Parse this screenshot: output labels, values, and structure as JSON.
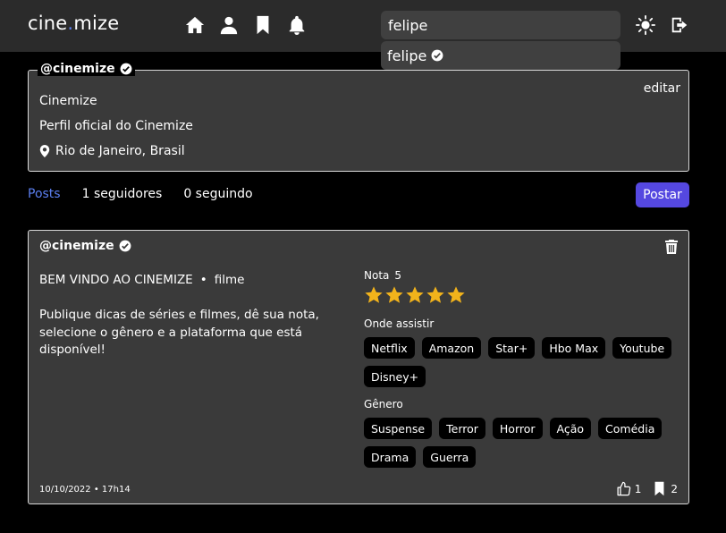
{
  "app": {
    "logo_left": "cine",
    "logo_dot": ".",
    "logo_right": "mize"
  },
  "nav": {
    "icons": [
      "home-icon",
      "user-icon",
      "bookmark-icon",
      "bell-icon"
    ],
    "right_icons": [
      "sun-icon",
      "logout-icon"
    ]
  },
  "search": {
    "value": "felipe",
    "results": [
      {
        "name": "felipe",
        "verified": true
      }
    ]
  },
  "profile": {
    "handle": "@cinemize",
    "verified": true,
    "edit_label": "editar",
    "name": "Cinemize",
    "bio": "Perfil oficial do Cinemize",
    "location": "Rio de Janeiro, Brasil"
  },
  "tabs": {
    "posts": "Posts",
    "followers": "1 seguidores",
    "following": "0 seguindo",
    "post_button": "Postar"
  },
  "post": {
    "handle": "@cinemize",
    "verified": true,
    "title": "BEM VINDO AO CINEMIZE",
    "separator": "•",
    "type": "filme",
    "body": "Publique dicas de séries e filmes, dê sua nota, selecione o gênero e a plataforma que está disponível!",
    "rating_label": "Nota",
    "rating_value": "5",
    "stars": 5,
    "star_color": "#f2b31b",
    "where_label": "Onde assistir",
    "platforms": [
      "Netflix",
      "Amazon",
      "Star+",
      "Hbo Max",
      "Youtube",
      "Disney+"
    ],
    "genre_label": "Gênero",
    "genres": [
      "Suspense",
      "Terror",
      "Horror",
      "Ação",
      "Comédia",
      "Drama",
      "Guerra"
    ],
    "date": "10/10/2022 • 17h14",
    "likes": "1",
    "saves": "2"
  },
  "colors": {
    "accent": "#5b7ff0",
    "button": "#5548e0",
    "card": "#3a3a3a",
    "topbar": "#2b2b2b"
  }
}
